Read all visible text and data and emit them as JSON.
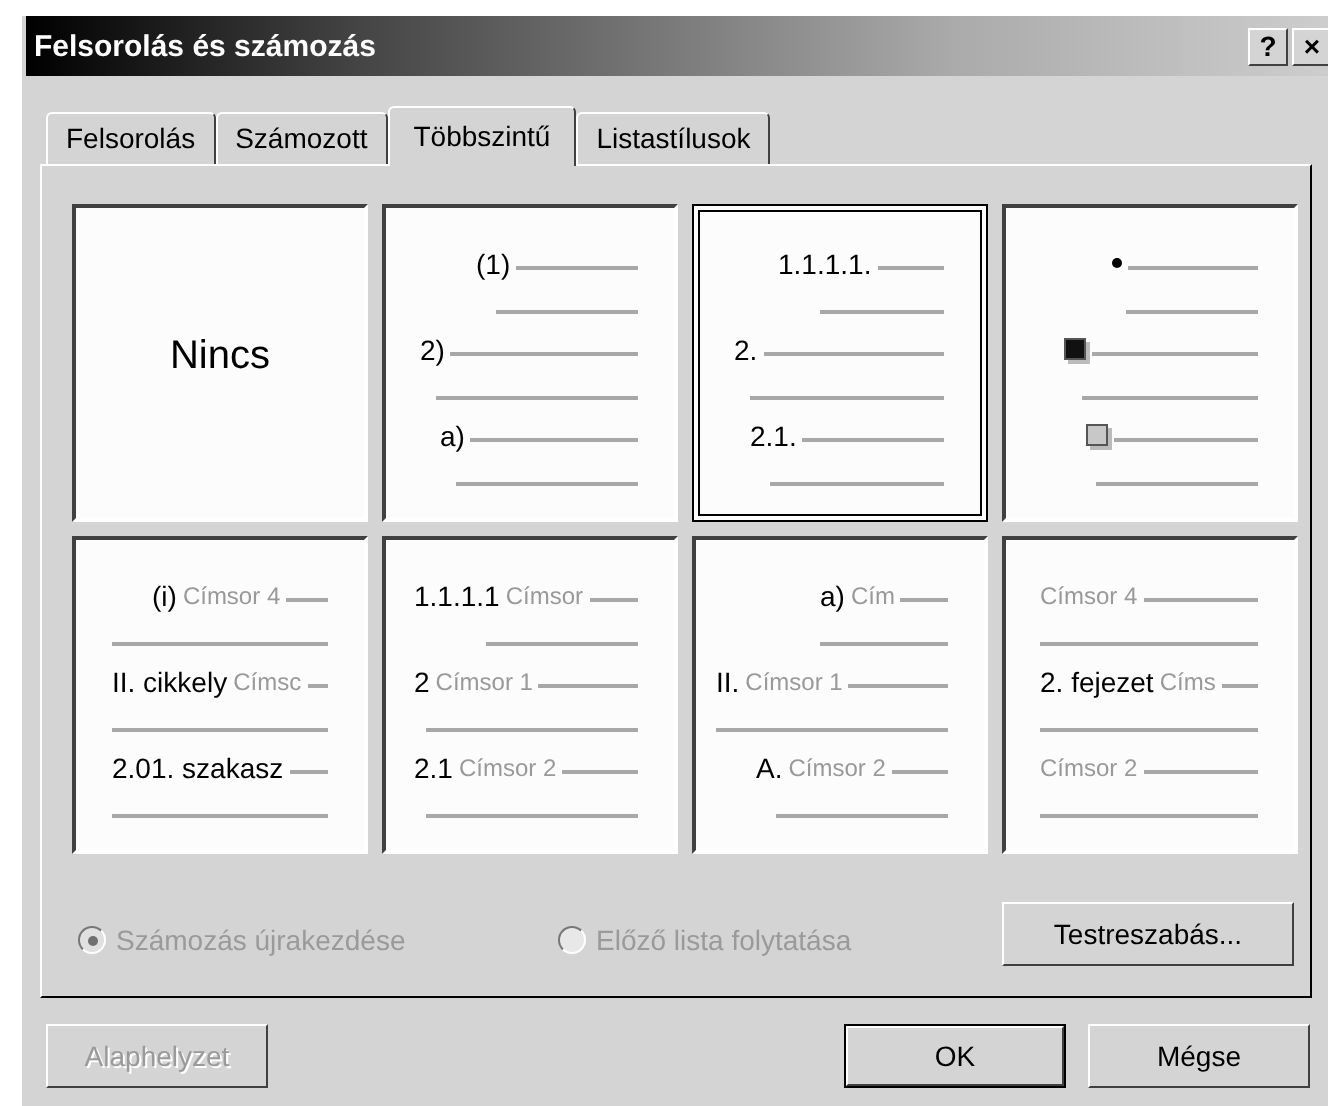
{
  "window": {
    "title": "Felsorolás és számozás",
    "help_button": "?",
    "close_button": "×"
  },
  "tabs": [
    {
      "label": "Felsorolás",
      "selected": false
    },
    {
      "label": "Számozott",
      "selected": false
    },
    {
      "label": "Többszintű",
      "selected": true
    },
    {
      "label": "Listastílusok",
      "selected": false
    }
  ],
  "presets": [
    {
      "kind": "none",
      "label": "Nincs",
      "selected": false
    },
    {
      "kind": "numbered",
      "selected": false,
      "rows": [
        {
          "number": "(1)"
        },
        {
          "number": "2)"
        },
        {
          "number": "a)"
        }
      ]
    },
    {
      "kind": "numbered",
      "selected": true,
      "rows": [
        {
          "number": "1.1.1.1."
        },
        {
          "number": "2."
        },
        {
          "number": "2.1."
        }
      ]
    },
    {
      "kind": "bulleted",
      "selected": false,
      "rows": [
        {
          "kind": "dot",
          "color": "#000000"
        },
        {
          "kind": "square",
          "color": "#111111"
        },
        {
          "kind": "square",
          "color": "#c8c8c8"
        }
      ]
    },
    {
      "kind": "numbered",
      "selected": false,
      "rows": [
        {
          "number": "(i)",
          "caption": "Címsor 4"
        },
        {
          "number": "II. cikkely",
          "caption": "Címsc"
        },
        {
          "number": "2.01. szakasz"
        }
      ]
    },
    {
      "kind": "numbered",
      "selected": false,
      "rows": [
        {
          "number": "1.1.1.1",
          "caption": "Címsor"
        },
        {
          "number": "2",
          "caption": "Címsor 1"
        },
        {
          "number": "2.1",
          "caption": "Címsor 2"
        }
      ]
    },
    {
      "kind": "numbered",
      "selected": false,
      "rows": [
        {
          "number": "a)",
          "caption": "Cím"
        },
        {
          "number": "II.",
          "caption": "Címsor 1"
        },
        {
          "number": "A.",
          "caption": "Címsor 2"
        }
      ]
    },
    {
      "kind": "numbered",
      "selected": false,
      "rows": [
        {
          "caption": "Címsor 4"
        },
        {
          "number": "2. fejezet",
          "caption": "Címs"
        },
        {
          "caption": "Címsor 2"
        }
      ]
    }
  ],
  "options": [
    {
      "label": "Számozás újrakezdése",
      "selected": true,
      "disabled": true
    },
    {
      "label": "Előző lista folytatása",
      "selected": false,
      "disabled": true
    }
  ],
  "customize_button": "Testreszabás...",
  "buttons": [
    {
      "label": "Alaphelyzet",
      "disabled": true,
      "default": false
    },
    {
      "label": "OK",
      "disabled": false,
      "default": true
    },
    {
      "label": "Mégse",
      "disabled": false,
      "default": false
    }
  ]
}
